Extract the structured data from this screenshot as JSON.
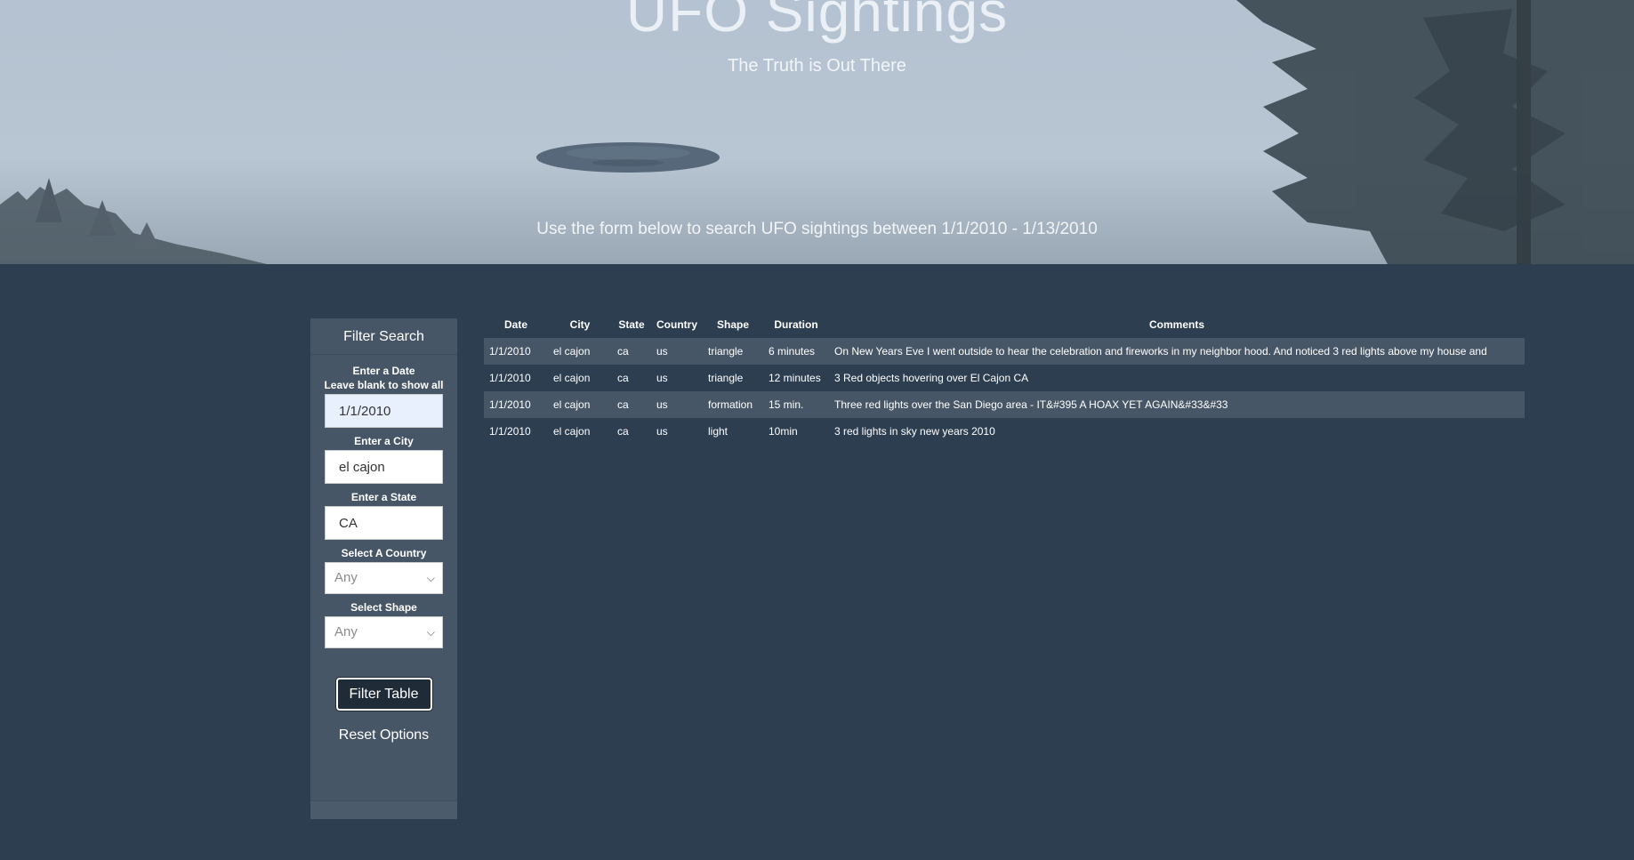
{
  "hero": {
    "title": "UFO Sightings",
    "subtitle": "The Truth is Out There",
    "instructions": "Use the form below to search UFO sightings between 1/1/2010 - 1/13/2010"
  },
  "filters": {
    "header": "Filter Search",
    "date_label_line1": "Enter a Date",
    "date_label_line2": "Leave blank to show all",
    "date_value": "1/1/2010",
    "city_label": "Enter a City",
    "city_value": "el cajon",
    "state_label": "Enter a State",
    "state_value": "CA",
    "country_label": "Select A Country",
    "country_selected": "Any",
    "shape_label": "Select Shape",
    "shape_selected": "Any",
    "filter_button": "Filter Table",
    "reset_link": "Reset Options"
  },
  "table": {
    "headers": [
      "Date",
      "City",
      "State",
      "Country",
      "Shape",
      "Duration",
      "Comments"
    ],
    "rows": [
      [
        "1/1/2010",
        "el cajon",
        "ca",
        "us",
        "triangle",
        "6 minutes",
        "On New Years Eve I went outside to hear the celebration and fireworks in my neighbor hood. And noticed 3 red lights above my house and"
      ],
      [
        "1/1/2010",
        "el cajon",
        "ca",
        "us",
        "triangle",
        "12 minutes",
        "3 Red objects hovering over El Cajon CA"
      ],
      [
        "1/1/2010",
        "el cajon",
        "ca",
        "us",
        "formation",
        "15 min.",
        "Three red lights over the San Diego area - IT&#395 A HOAX YET AGAIN&#33&#33"
      ],
      [
        "1/1/2010",
        "el cajon",
        "ca",
        "us",
        "light",
        "10min",
        "3 red lights in sky new years 2010"
      ]
    ]
  },
  "colors": {
    "page_background": "#2c3e50",
    "sidebar_background": "#475666",
    "row_stripe": "#475666",
    "button_background": "#1f2b37"
  }
}
